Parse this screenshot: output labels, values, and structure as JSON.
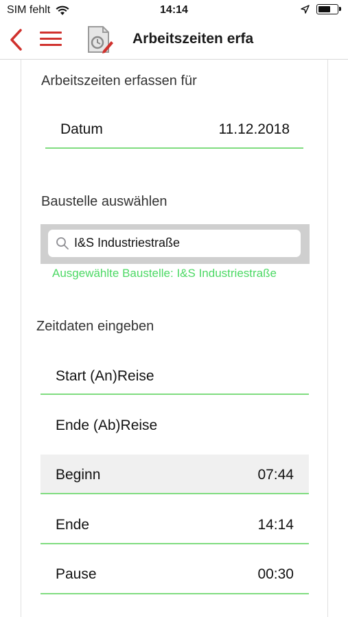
{
  "status_bar": {
    "carrier": "SIM fehlt",
    "time": "14:14",
    "battery_level_percent": 65
  },
  "nav": {
    "title": "Arbeitszeiten erfa"
  },
  "form": {
    "heading_for": "Arbeitszeiten erfassen für",
    "date": {
      "label": "Datum",
      "value": "11.12.2018"
    },
    "site_heading": "Baustelle auswählen",
    "search": {
      "value": "I&S Industriestraße"
    },
    "selected_site": "Ausgewählte Baustelle: I&S Industriestraße",
    "time_heading": "Zeitdaten eingeben",
    "rows": [
      {
        "label": "Start (An)Reise",
        "value": ""
      },
      {
        "label": "Ende (Ab)Reise",
        "value": ""
      },
      {
        "label": "Beginn",
        "value": "07:44"
      },
      {
        "label": "Ende",
        "value": "14:14"
      },
      {
        "label": "Pause",
        "value": "00:30"
      }
    ]
  },
  "colors": {
    "accent_red": "#d0312d",
    "success_green": "#4cd964",
    "divider_green": "#7fdc7f"
  }
}
